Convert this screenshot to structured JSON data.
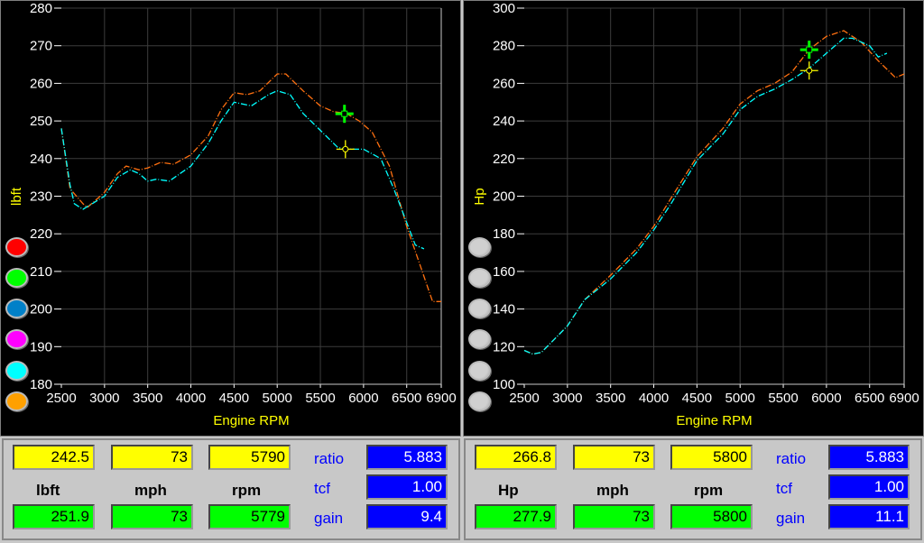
{
  "colors": {
    "series_a": "#ff7010",
    "series_b": "#00ffff",
    "cursor_a": "#00ff00",
    "cursor_b": "#ffff00"
  },
  "legend_left": [
    "#ff0000",
    "#00ff00",
    "#0080c8",
    "#ff00ff",
    "#00ffff",
    "#ffa000"
  ],
  "legend_right": [
    "#d0d0d0",
    "#d0d0d0",
    "#d0d0d0",
    "#d0d0d0",
    "#d0d0d0",
    "#d0d0d0"
  ],
  "chart_data": [
    {
      "type": "line",
      "xlabel": "Engine RPM",
      "ylabel": "lbft",
      "xlim": [
        2500,
        6900
      ],
      "ylim": [
        180,
        280
      ],
      "xticks": [
        "2500",
        "3000",
        "3500",
        "4000",
        "4500",
        "5000",
        "5500",
        "6000",
        "6500",
        "6900"
      ],
      "yticks": [
        "180",
        "190",
        "200",
        "210",
        "220",
        "230",
        "240",
        "250",
        "260",
        "270",
        "280"
      ],
      "grid": true,
      "series": [
        {
          "color": "#ff7010",
          "x": [
            2500,
            2600,
            2750,
            2800,
            3000,
            3150,
            3250,
            3400,
            3500,
            3650,
            3800,
            4000,
            4200,
            4350,
            4500,
            4650,
            4800,
            5000,
            5100,
            5300,
            5500,
            5650,
            5800,
            5950,
            6100,
            6300,
            6500,
            6650,
            6800,
            6900
          ],
          "y": [
            248,
            232,
            228,
            227,
            231,
            236,
            238,
            237,
            237.5,
            239,
            238.5,
            241,
            246,
            253,
            257.5,
            257,
            258,
            262.5,
            262.5,
            258,
            254,
            252.5,
            252,
            250,
            247,
            238,
            222,
            212,
            202,
            202
          ]
        },
        {
          "color": "#00ffff",
          "x": [
            2500,
            2600,
            2650,
            2750,
            3000,
            3150,
            3300,
            3400,
            3500,
            3600,
            3750,
            4000,
            4200,
            4350,
            4500,
            4700,
            4900,
            5000,
            5150,
            5300,
            5500,
            5700,
            5800,
            6000,
            6200,
            6350,
            6500,
            6600,
            6700
          ],
          "y": [
            248,
            233,
            228,
            226.5,
            230,
            235,
            237,
            236,
            234,
            234.5,
            234,
            238,
            244,
            250,
            255,
            254,
            257,
            258,
            257,
            252,
            247.5,
            243,
            242.5,
            242.5,
            240,
            232,
            223,
            217,
            216
          ]
        }
      ],
      "cursors": [
        {
          "color": "#00ff00",
          "shape": "square",
          "x": 5779,
          "y": 251.9
        },
        {
          "color": "#ffff00",
          "shape": "circle",
          "x": 5790,
          "y": 242.5
        }
      ]
    },
    {
      "type": "line",
      "xlabel": "Engine RPM",
      "ylabel": "Hp",
      "xlim": [
        2500,
        6900
      ],
      "ylim": [
        100,
        300
      ],
      "xticks": [
        "2500",
        "3000",
        "3500",
        "4000",
        "4500",
        "5000",
        "5500",
        "6000",
        "6500",
        "6900"
      ],
      "yticks": [
        "100",
        "120",
        "140",
        "160",
        "180",
        "200",
        "220",
        "240",
        "260",
        "280",
        "300"
      ],
      "grid": true,
      "series": [
        {
          "color": "#ff7010",
          "x": [
            2500,
            2600,
            2700,
            3000,
            3200,
            3500,
            3800,
            4000,
            4200,
            4500,
            4800,
            5000,
            5200,
            5400,
            5600,
            5800,
            6000,
            6200,
            6400,
            6600,
            6800,
            6900
          ],
          "y": [
            118,
            116,
            117,
            131,
            145,
            158,
            172,
            184,
            199,
            221,
            236,
            249,
            256,
            260,
            266,
            278,
            285,
            288,
            282,
            272,
            263,
            265
          ]
        },
        {
          "color": "#00ffff",
          "x": [
            2500,
            2600,
            2700,
            3000,
            3200,
            3500,
            3800,
            4000,
            4200,
            4500,
            4800,
            5000,
            5200,
            5400,
            5600,
            5800,
            6000,
            6200,
            6300,
            6500,
            6600,
            6700
          ],
          "y": [
            118,
            116,
            117,
            131,
            145,
            156,
            170,
            182,
            196,
            219,
            233,
            246,
            253,
            257,
            262,
            268,
            276,
            284,
            284,
            280,
            274,
            276
          ]
        }
      ],
      "cursors": [
        {
          "color": "#00ff00",
          "shape": "square",
          "x": 5800,
          "y": 277.9
        },
        {
          "color": "#ffff00",
          "shape": "circle",
          "x": 5800,
          "y": 266.8
        }
      ]
    }
  ],
  "panel_left": {
    "yellow": [
      "242.5",
      "73",
      "5790"
    ],
    "labels": [
      "lbft",
      "mph",
      "rpm"
    ],
    "green": [
      "251.9",
      "73",
      "5779"
    ],
    "blue_labels": [
      "ratio",
      "tcf",
      "gain"
    ],
    "blue": [
      "5.883",
      "1.00",
      "9.4"
    ]
  },
  "panel_right": {
    "yellow": [
      "266.8",
      "73",
      "5800"
    ],
    "labels": [
      "Hp",
      "mph",
      "rpm"
    ],
    "green": [
      "277.9",
      "73",
      "5800"
    ],
    "blue_labels": [
      "ratio",
      "tcf",
      "gain"
    ],
    "blue": [
      "5.883",
      "1.00",
      "11.1"
    ]
  }
}
